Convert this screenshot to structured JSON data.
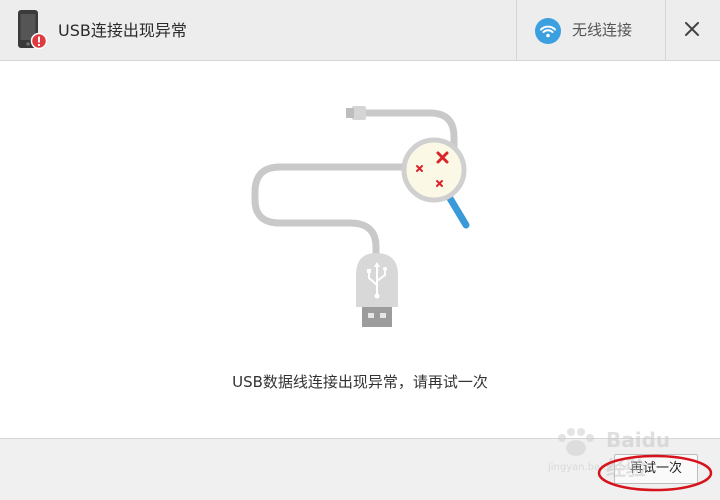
{
  "window": {
    "title": "USB连接出现异常",
    "app_icon": "phone-error-icon"
  },
  "toolbar": {
    "wifi_label": "无线连接",
    "wifi_icon": "wifi-icon",
    "close_icon": "close-icon"
  },
  "main": {
    "illustration_icon": "usb-cable-magnifier-icon",
    "message": "USB数据线连接出现异常，请再试一次"
  },
  "footer": {
    "retry_label": "再试一次"
  },
  "watermark": {
    "brand": "Baidu经验",
    "url": "jingyan.baidu.com"
  },
  "colors": {
    "titlebar_bg": "#ededed",
    "wifi_accent": "#3b9fe0",
    "error_red": "#d9262b",
    "annotation_red": "#d6121b",
    "magnifier_handle": "#3a99d8",
    "magnifier_lens": "#fbf8e6"
  }
}
